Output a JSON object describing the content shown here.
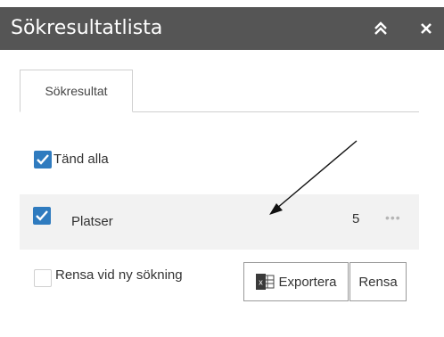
{
  "header": {
    "title": "Sökresultatlista"
  },
  "tabs": [
    {
      "label": "Sökresultat"
    }
  ],
  "toggle_all": {
    "label": "Tänd alla",
    "checked": true
  },
  "layers": [
    {
      "label": "Platser",
      "count": "5",
      "checked": true
    }
  ],
  "clear_on_new_search": {
    "label": "Rensa vid ny sökning",
    "checked": false
  },
  "buttons": {
    "export_label": "Exportera",
    "clear_label": "Rensa"
  },
  "icons": {
    "collapse": "double-chevron-up-icon",
    "close": "close-icon",
    "more": "more-dots-icon",
    "export": "excel-icon"
  },
  "colors": {
    "header_bg": "#555555",
    "checkbox_accent": "#2f7bbf",
    "row_highlight": "#f2f2f2"
  }
}
